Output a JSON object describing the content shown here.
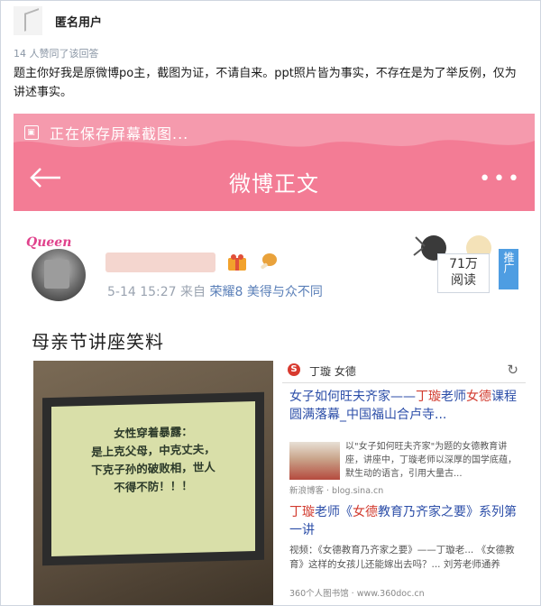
{
  "answer": {
    "username": "匿名用户",
    "likes_text": "14 人赞同了该回答",
    "body": "题主你好我是原微博po主，截图为证，不请自来。ppt照片皆为事实，不存在是为了举反例，仅为讲述事实。"
  },
  "screenshot": {
    "saving_text": "正在保存屏幕截图...",
    "page_title": "微博正文",
    "queen_label": "Queen",
    "post_meta_time": "5-14 15:27",
    "post_meta_from": "来自",
    "post_meta_source": "荣耀8 美得与众不同",
    "reads_count": "71万",
    "reads_label": "阅读",
    "promote_label": "推广",
    "post_title": "母亲节讲座笑料",
    "slide_lines": [
      "女性穿着暴露：",
      "是上克父母，中克丈夫，",
      "下克子孙的破败相，世人",
      "不得不防！！！"
    ],
    "search": {
      "query": "丁璇 女德",
      "result1_title_a": "女子如何旺夫齐家——",
      "result1_title_hl1": "丁璇",
      "result1_title_b": "老师",
      "result1_title_hl2": "女德",
      "result1_title_c": "课程圆满落幕_中国福山合卢寺...",
      "result1_snippet": "以\"女子如何旺夫齐家\"为题的女德教育讲座，讲座中，丁璇老师以深厚的国学底蕴，默生动的语言，引用大量古...",
      "result1_source": "新浪博客 · blog.sina.cn",
      "result2_title_a": "丁璇",
      "result2_title_b": "老师《",
      "result2_title_hl": "女德",
      "result2_title_c": "教育乃齐家之要》系列第一讲",
      "result2_snippet": "视频：《女德教育乃齐家之要》——丁璇老... 《女德教育》这样的女孩儿还能嫁出去吗？... 刘芳老师通养",
      "result2_source": "360个人图书馆 · www.360doc.cn"
    }
  }
}
